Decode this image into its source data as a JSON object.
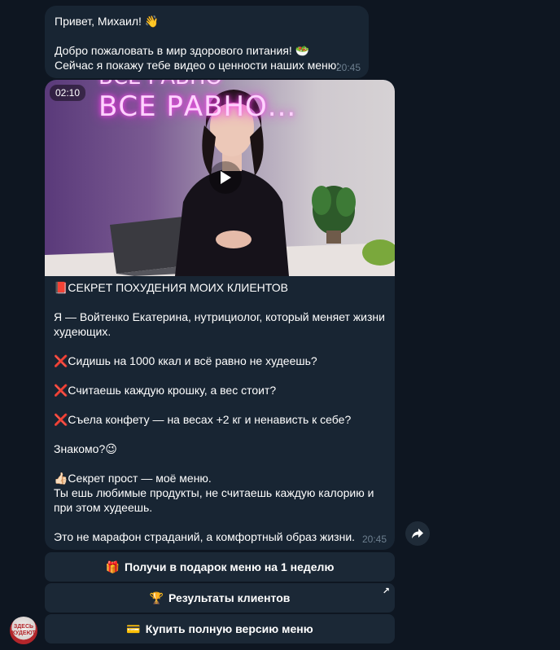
{
  "message1": {
    "lines": [
      "Привет, Михаил! 👋",
      "",
      "Добро пожаловать в мир здорового питания! 🥗",
      "Сейчас я покажу тебе видео о ценности наших меню:"
    ],
    "time": "20:45"
  },
  "message2": {
    "video": {
      "duration": "02:10",
      "neon_text_top": "ВСЁ РАВНО",
      "neon_text": "ВСЕ РАВНО..."
    },
    "caption": [
      "📕СЕКРЕТ ПОХУДЕНИЯ МОИХ КЛИЕНТОВ",
      "",
      " Я — Войтенко Екатерина, нутрициолог, который меняет жизни худеющих.",
      "",
      "❌Сидишь на 1000 ккал и всё равно не худеешь?",
      "",
      "❌Считаешь каждую крошку, а вес стоит?",
      "",
      "❌Съела конфету — на весах +2 кг и ненависть к себе?",
      "",
      "Знакомо?😉",
      "",
      "👍🏻Секрет прост — моё меню.",
      "Ты ешь любимые продукты, не считаешь каждую калорию и при этом худеешь.",
      "",
      "Это не марафон страданий, а комфортный образ жизни."
    ],
    "time": "20:45"
  },
  "keyboard": [
    {
      "emoji": "🎁",
      "label": "Получи в подарок меню на 1 неделю"
    },
    {
      "emoji": "🏆",
      "label": "Результаты клиентов",
      "external": "↗"
    },
    {
      "emoji": "💳",
      "label": "Купить полную версию меню"
    }
  ],
  "avatar": {
    "text_top": "ЗДЕСЬ",
    "text_bottom": "ХУДЕЮТ"
  },
  "icons": {
    "share": "share-icon",
    "play": "play-icon"
  }
}
